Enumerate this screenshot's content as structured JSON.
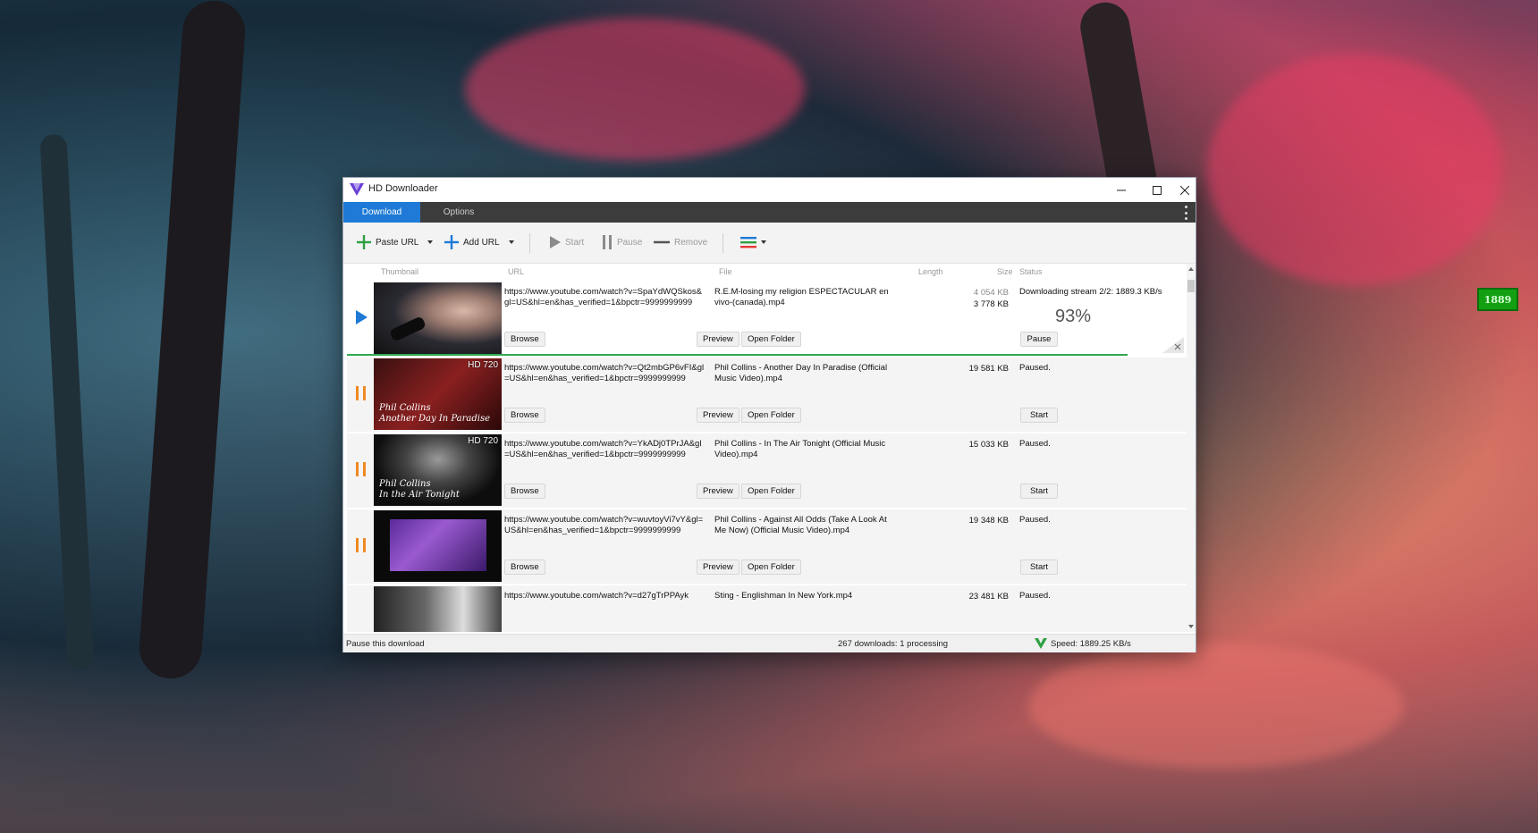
{
  "window": {
    "title": "HD Downloader"
  },
  "tabs": [
    {
      "label": "Download"
    },
    {
      "label": "Options"
    }
  ],
  "toolbar": {
    "paste_url": "Paste URL",
    "add_url": "Add URL",
    "start": "Start",
    "pause": "Pause",
    "remove": "Remove"
  },
  "columns": {
    "thumbnail": "Thumbnail",
    "url": "URL",
    "file": "File",
    "length": "Length",
    "size": "Size",
    "status": "Status"
  },
  "rows": [
    {
      "state": "downloading",
      "url": "https://www.youtube.com/watch?v=SpaYdWQSkos&gl=US&hl=en&has_verified=1&bpctr=9999999999",
      "file": "R.E.M-losing my religion ESPECTACULAR en vivo-(canada).mp4",
      "size_a": "4 054 KB",
      "size_b": "3 778 KB",
      "status": "Downloading stream 2/2: 1889.3 KB/s",
      "percent": "93%",
      "progress_fraction": 0.93,
      "browse": "Browse",
      "preview": "Preview",
      "open_folder": "Open Folder",
      "action": "Pause"
    },
    {
      "state": "paused",
      "badge": "HD 720",
      "thumb_text": "Phil Collins\nAnother Day In Paradise",
      "url": "https://www.youtube.com/watch?v=Qt2mbGP6vFI&gl=US&hl=en&has_verified=1&bpctr=9999999999",
      "file": "Phil Collins - Another Day In Paradise (Official Music Video).mp4",
      "size_a": "19 581 KB",
      "status": "Paused.",
      "browse": "Browse",
      "preview": "Preview",
      "open_folder": "Open Folder",
      "action": "Start"
    },
    {
      "state": "paused",
      "badge": "HD 720",
      "thumb_text": "Phil Collins\nIn the Air Tonight",
      "url": "https://www.youtube.com/watch?v=YkADj0TPrJA&gl=US&hl=en&has_verified=1&bpctr=9999999999",
      "file": "Phil Collins - In The Air Tonight (Official Music Video).mp4",
      "size_a": "15 033 KB",
      "status": "Paused.",
      "browse": "Browse",
      "preview": "Preview",
      "open_folder": "Open Folder",
      "action": "Start"
    },
    {
      "state": "paused",
      "url": "https://www.youtube.com/watch?v=wuvtoyVi7vY&gl=US&hl=en&has_verified=1&bpctr=9999999999",
      "file": "Phil Collins - Against All Odds (Take A Look At Me Now) (Official Music Video).mp4",
      "size_a": "19 348 KB",
      "status": "Paused.",
      "browse": "Browse",
      "preview": "Preview",
      "open_folder": "Open Folder",
      "action": "Start"
    },
    {
      "state": "paused",
      "url": "https://www.youtube.com/watch?v=d27gTrPPAyk",
      "file": "Sting - Englishman In New York.mp4",
      "size_a": "23 481 KB",
      "status": "Paused."
    }
  ],
  "statusbar": {
    "hint": "Pause this download",
    "count": "267 downloads: 1 processing",
    "speed": "Speed: 1889.25 KB/s"
  },
  "desktop": {
    "badge": "1889"
  },
  "colors": {
    "accent": "#1e7ad6",
    "progress": "#2fa84f",
    "paused": "#f08a24",
    "play": "#1e7ad6"
  }
}
